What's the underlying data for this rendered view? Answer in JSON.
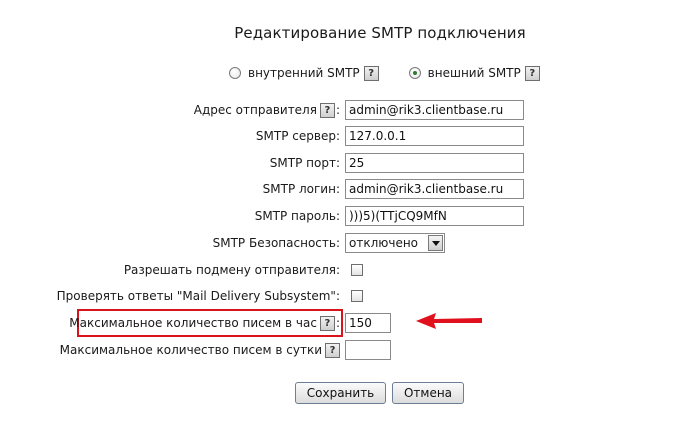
{
  "title": "Редактирование SMTP подключения",
  "mode": {
    "internal_label": "внутренний SMTP",
    "external_label": "внешний SMTP",
    "help_glyph": "?",
    "selected": "external"
  },
  "fields": {
    "sender_address": {
      "label": "Адрес отправителя",
      "value": "admin@rik3.clientbase.ru"
    },
    "smtp_server": {
      "label": "SMTP сервер:",
      "value": "127.0.0.1"
    },
    "smtp_port": {
      "label": "SMTP порт:",
      "value": "25"
    },
    "smtp_login": {
      "label": "SMTP логин:",
      "value": "admin@rik3.clientbase.ru"
    },
    "smtp_password": {
      "label": "SMTP пароль:",
      "value": ")))5)(TTjCQ9MfN"
    },
    "smtp_security": {
      "label": "SMTP Безопасность:",
      "value": "отключено"
    },
    "allow_sender_spoof": {
      "label": "Разрешать подмену отправителя:",
      "checked": false
    },
    "check_mail_delivery": {
      "label": "Проверять ответы \"Mail Delivery Subsystem\":",
      "checked": false
    },
    "max_per_hour": {
      "label": "Максимальное количество писем в час",
      "value": "150"
    },
    "max_per_day": {
      "label": "Максимальное количество писем в сутки",
      "value": ""
    }
  },
  "buttons": {
    "save_label": "Сохранить",
    "cancel_label": "Отмена"
  },
  "annotation": {
    "highlight_color": "#d8141a",
    "arrow_color": "#e0101c"
  },
  "colon": ":"
}
